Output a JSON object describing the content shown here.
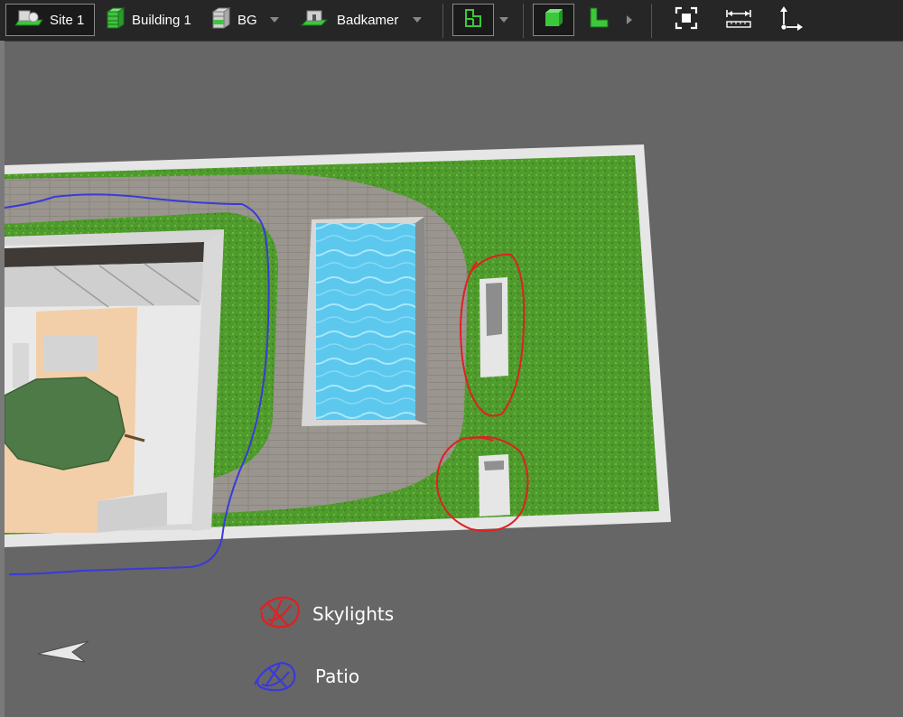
{
  "toolbar": {
    "site_label": "Site 1",
    "building_label": "Building 1",
    "level_label": "BG",
    "room_label": "Badkamer"
  },
  "legend": {
    "skylights_label": "Skylights",
    "patio_label": "Patio"
  },
  "colors": {
    "skylights_marker": "#e02020",
    "patio_marker": "#3a3ad8",
    "lawn": "#4f9a2c",
    "pool_water": "#5cc8ee",
    "paving": "#9a958e",
    "toolbar_bg": "#262626",
    "viewport_bg": "#666666"
  },
  "icons": {
    "site": "site-icon",
    "building": "building-icon",
    "level": "level-icon",
    "room": "room-icon",
    "plan_view": "floorplan-icon",
    "view_3d": "cube-icon",
    "wall_tool": "l-shape-icon",
    "fit_view": "fit-view-icon",
    "measure": "measure-icon",
    "axes": "axes-icon",
    "navigation": "navigation-arrow-icon"
  }
}
